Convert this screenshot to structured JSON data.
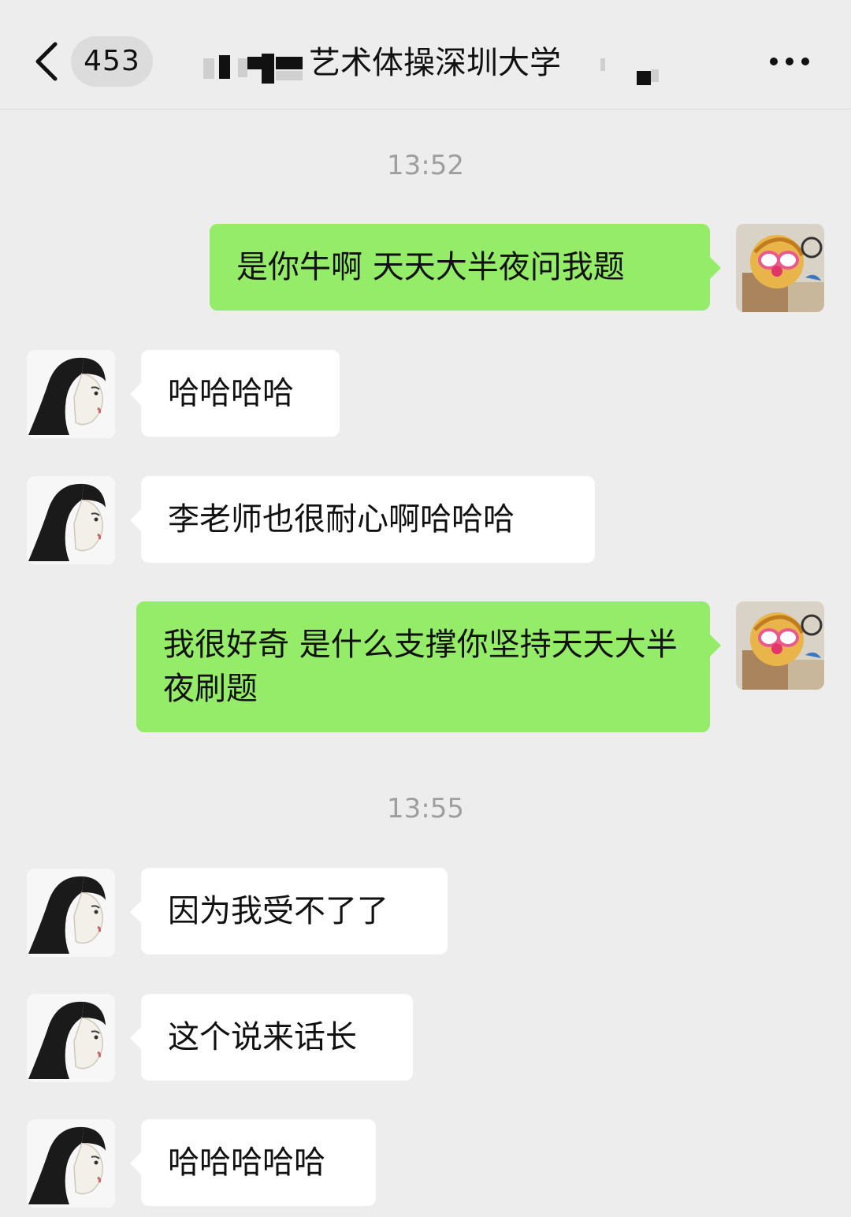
{
  "header": {
    "unread_count": "453",
    "title": "艺术体操深圳大学"
  },
  "colors": {
    "background": "#ededed",
    "incoming_bubble": "#ffffff",
    "outgoing_bubble": "#95ec69",
    "timestamp": "#9e9e9e"
  },
  "messages": [
    {
      "type": "time",
      "text": "13:52"
    },
    {
      "type": "out",
      "text": "是你牛啊 天天大半夜问我题"
    },
    {
      "type": "in",
      "text": "哈哈哈哈"
    },
    {
      "type": "in",
      "text": "李老师也很耐心啊哈哈哈"
    },
    {
      "type": "out",
      "text": "我很好奇 是什么支撑你坚持天天大半夜刷题"
    },
    {
      "type": "time",
      "text": "13:55"
    },
    {
      "type": "in",
      "text": "因为我受不了了"
    },
    {
      "type": "in",
      "text": "这个说来话长"
    },
    {
      "type": "in",
      "text": "哈哈哈哈哈"
    }
  ]
}
